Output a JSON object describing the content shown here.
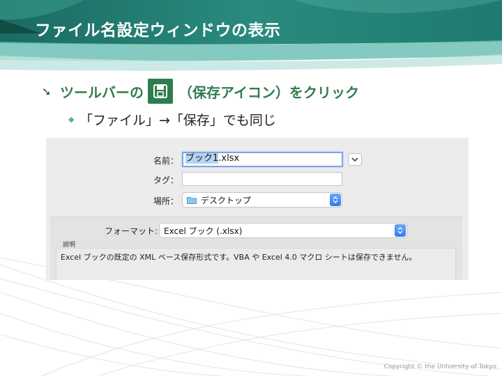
{
  "slide": {
    "title": "ファイル名設定ウィンドウの表示",
    "bullet1_before": "ツールバーの",
    "bullet1_after": "（保存アイコン）をクリック",
    "bullet2": "「ファイル」→「保存」でも同じ",
    "copyright": "Copyright © the University of Tokyo"
  },
  "dialog": {
    "name_label": "名前：",
    "name_selected": "ブック1",
    "name_ext": ".xlsx",
    "tag_label": "タグ：",
    "tag_value": "",
    "location_label": "場所：",
    "location_value": "デスクトップ",
    "format_label": "フォーマット:",
    "format_value": "Excel ブック (.xlsx)",
    "desc_label": "説明",
    "desc_text": "Excel ブックの既定の XML ベース保存形式です。VBA や Excel 4.0 マクロ シートは保存できません。"
  },
  "colors": {
    "accent_green": "#2e7d4f",
    "header_teal": "#1f7a6f",
    "focus_blue": "#7aa7e6"
  },
  "icons": [
    "save-icon",
    "arrow-bullet-icon",
    "diamond-bullet-icon",
    "chevron-down-icon",
    "folder-icon",
    "stepper-icon"
  ]
}
